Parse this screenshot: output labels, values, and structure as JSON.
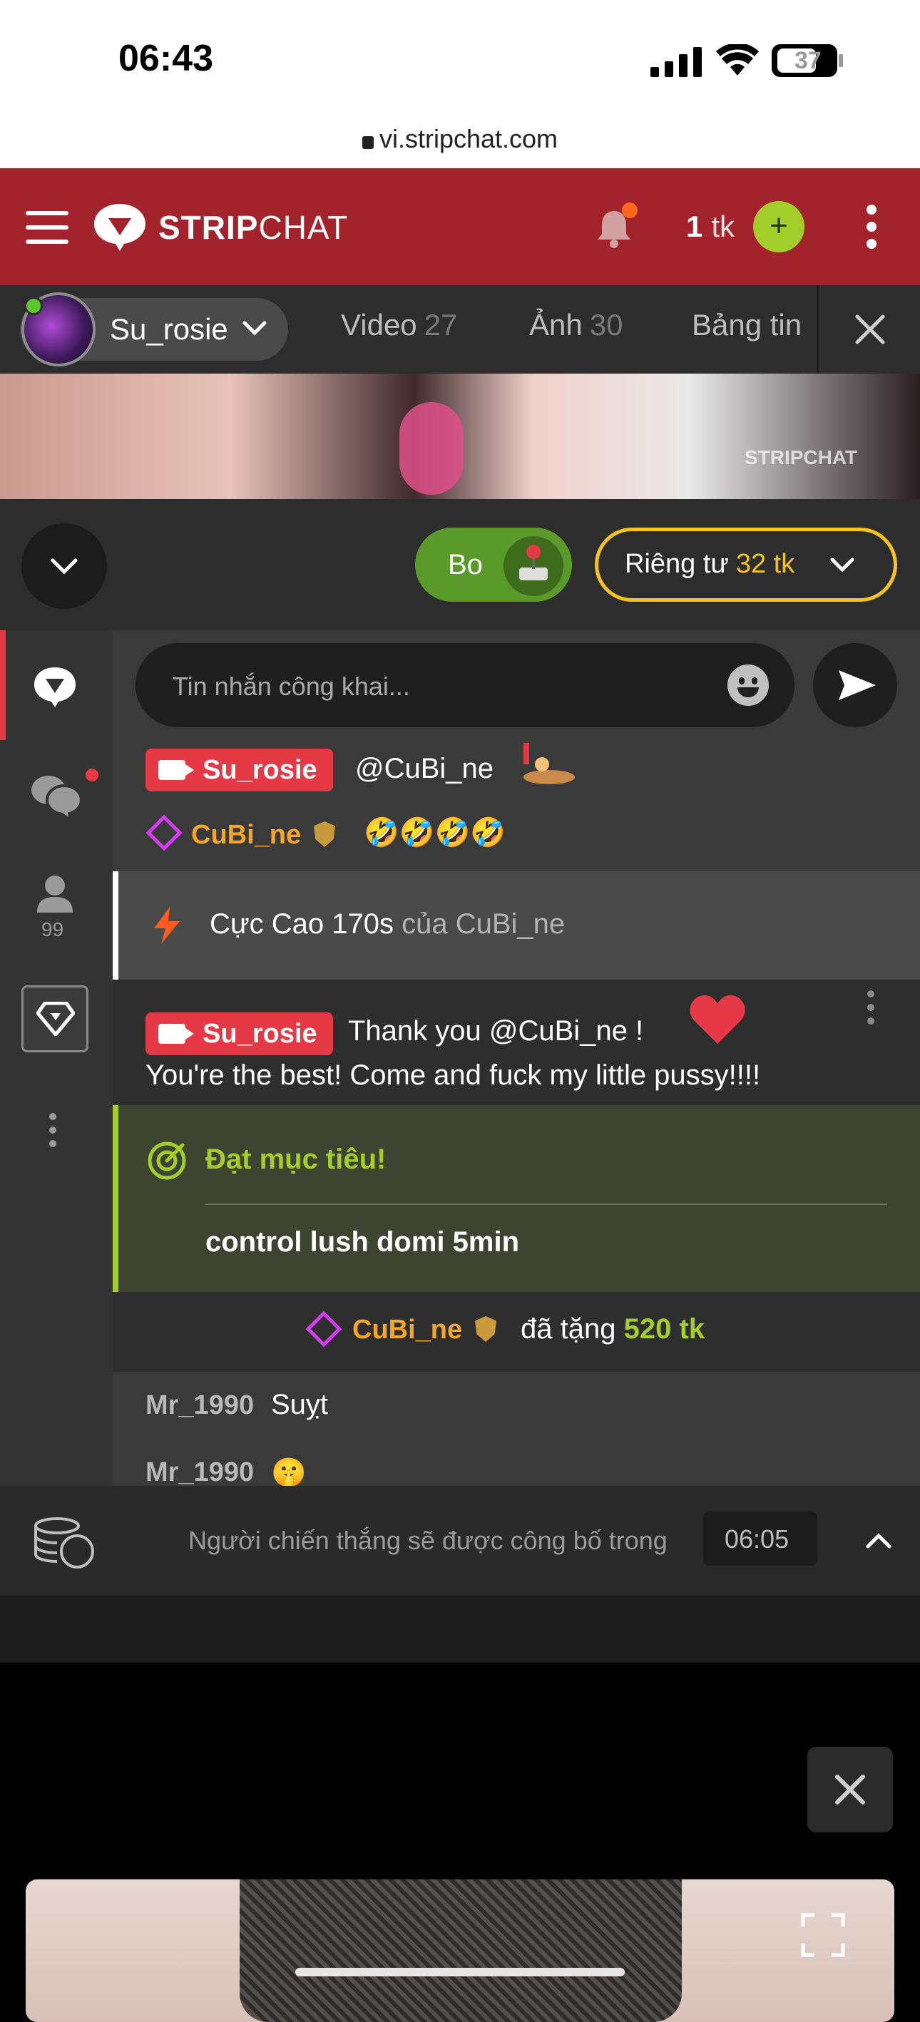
{
  "status": {
    "time": "06:43",
    "battery": "37"
  },
  "browser": {
    "url": "vi.stripchat.com"
  },
  "header": {
    "brand_strong": "STRIP",
    "brand_light": "CHAT",
    "token_count": "1",
    "token_unit": "tk",
    "add_label": "+"
  },
  "profile": {
    "username": "Su_rosie",
    "tabs": [
      {
        "label": "Video",
        "count": "27"
      },
      {
        "label": "Ảnh",
        "count": "30"
      },
      {
        "label": "Bảng tin",
        "count": ""
      }
    ]
  },
  "video": {
    "watermark": "STRIPCHAT"
  },
  "controls": {
    "bo_label": "Bo",
    "private_label": "Riêng tư",
    "private_price": "32 tk"
  },
  "sidebar": {
    "viewer_count": "99"
  },
  "chat": {
    "input_placeholder": "Tin nhắn công khai...",
    "messages": {
      "m1_user": "Su_rosie",
      "m1_text": "@CuBi_ne",
      "m2_user": "CuBi_ne",
      "m2_text": "🤣🤣🤣🤣",
      "tip_strong": "Cực Cao 170s",
      "tip_rest": " của CuBi_ne",
      "m3_user": "Su_rosie",
      "m3_text": "Thank you  @CuBi_ne !",
      "m3_line2": "You're the best! Come and fuck my little pussy!!!!",
      "goal_title": "Đạt mục tiêu!",
      "goal_text": "control lush domi 5min",
      "gift_user": "CuBi_ne",
      "gift_text": "đã tặng",
      "gift_amount": "520 tk",
      "m4_user": "Mr_1990",
      "m4_text": "Suỵt",
      "m5_user": "Mr_1990",
      "m5_text": "🤫"
    }
  },
  "bottom": {
    "winner_text": "Người chiến thắng sẽ được công bố trong",
    "timer": "06:05"
  },
  "colors": {
    "header_red": "#a3232c",
    "accent_green": "#a2cd2a",
    "gold": "#f5c41b",
    "broadcaster_red": "#e53946"
  }
}
